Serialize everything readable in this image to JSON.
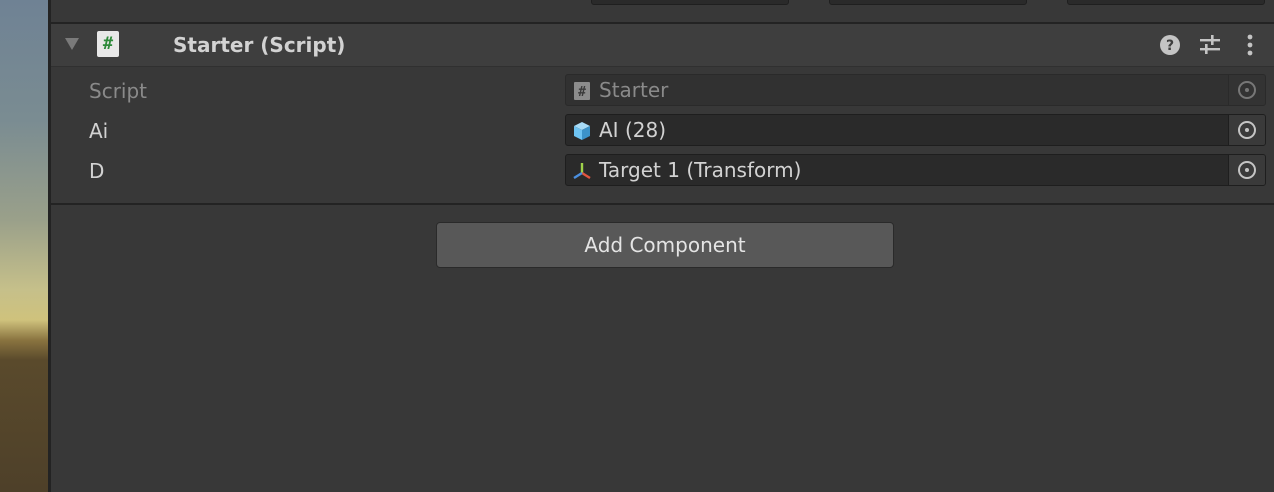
{
  "component": {
    "title": "Starter (Script)",
    "script_icon_glyph": "#",
    "header_icons": [
      "help-icon",
      "presets-icon",
      "more-options-icon"
    ]
  },
  "properties": [
    {
      "label": "Script",
      "value": "Starter",
      "icon": "script-icon",
      "disabled": true
    },
    {
      "label": "Ai",
      "value": "AI (28)",
      "icon": "gameobject-cube-icon",
      "disabled": false
    },
    {
      "label": "D",
      "value": "Target 1 (Transform)",
      "icon": "transform-icon",
      "disabled": false
    }
  ],
  "add_component_label": "Add Component",
  "colors": {
    "panel_bg": "#383838",
    "label_text": "#d2d2d2",
    "disabled_text": "#8a8a8a",
    "field_bg": "#2a2a2a",
    "button_bg": "#585858",
    "script_hash_green": "#2e8a3a",
    "cube_blue": "#6ec3f2"
  }
}
